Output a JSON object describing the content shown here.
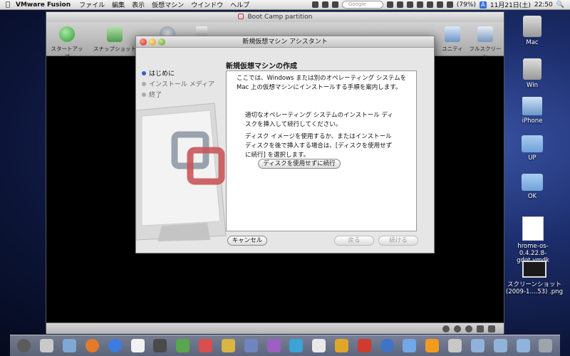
{
  "menubar": {
    "app_name": "VMware Fusion",
    "menus": [
      "ファイル",
      "編集",
      "表示",
      "仮想マシン",
      "ウインドウ",
      "ヘルプ"
    ],
    "search_placeholder": "Google",
    "battery": "(79%)",
    "input_badge": "A",
    "date": "11月21日(土)",
    "time": "22:50"
  },
  "window": {
    "title": "Boot Camp partition",
    "toolbar": {
      "start_up": "スタートアップ",
      "snapshot": "スナップショット",
      "unity": "ユニティ",
      "fullscreen": "フルスクリーン"
    }
  },
  "dialog": {
    "title": "新規仮想マシン アシスタント",
    "steps": [
      "はじめに",
      "インストール メディア",
      "終了"
    ],
    "heading": "新規仮想マシンの作成",
    "intro": "ここでは、Windows または別のオペレーティング システムを Mac 上の仮想マシンにインストールする手順を案内します。",
    "insert_text": "適切なオペレーティング システムのインストール ディスクを挿入して続行してください。",
    "image_text": "ディスク イメージを使用するか、またはインストール ディスクを後で挿入する場合は、[ディスクを使用せずに続行] を選択します。",
    "continue_without_disc": "ディスクを使用せずに続行",
    "cancel": "キャンセル",
    "back": "戻る",
    "continue": "続ける"
  },
  "desktop": {
    "icons": [
      {
        "label": "Mac"
      },
      {
        "label": "Win"
      },
      {
        "label": "iPhone"
      },
      {
        "label": "UP"
      },
      {
        "label": "OK"
      },
      {
        "label": "hrome-os-0.4.22.8-gdgt.vmdk"
      },
      {
        "label": "スクリーンショット (2009-1....53) .png"
      }
    ]
  },
  "colors": {
    "accent": "#2f63c9",
    "folder": "#7fb0e2"
  }
}
